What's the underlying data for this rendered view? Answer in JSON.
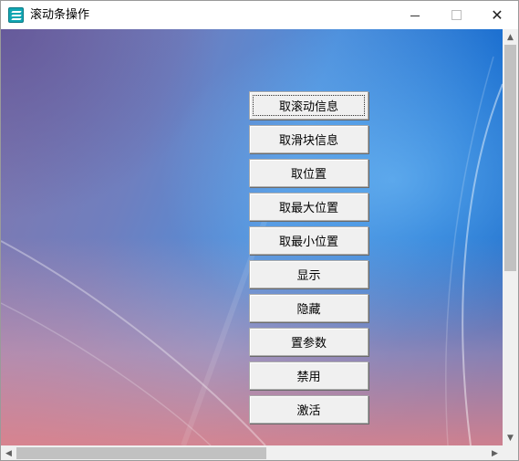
{
  "window": {
    "title": "滚动条操作",
    "icon": "app-icon",
    "controls": {
      "minimize": "minimize-icon",
      "maximize": "maximize-icon",
      "close": "✕"
    }
  },
  "buttons": [
    {
      "label": "取滚动信息",
      "focused": true
    },
    {
      "label": "取滑块信息"
    },
    {
      "label": "取位置"
    },
    {
      "label": "取最大位置"
    },
    {
      "label": "取最小位置"
    },
    {
      "label": "显示"
    },
    {
      "label": "隐藏"
    },
    {
      "label": "置参数"
    },
    {
      "label": "禁用"
    },
    {
      "label": "激活"
    }
  ],
  "scrollbars": {
    "vertical": {
      "up_arrow": "▲",
      "down_arrow": "▼"
    },
    "horizontal": {
      "left_arrow": "◀",
      "right_arrow": "▶"
    }
  }
}
